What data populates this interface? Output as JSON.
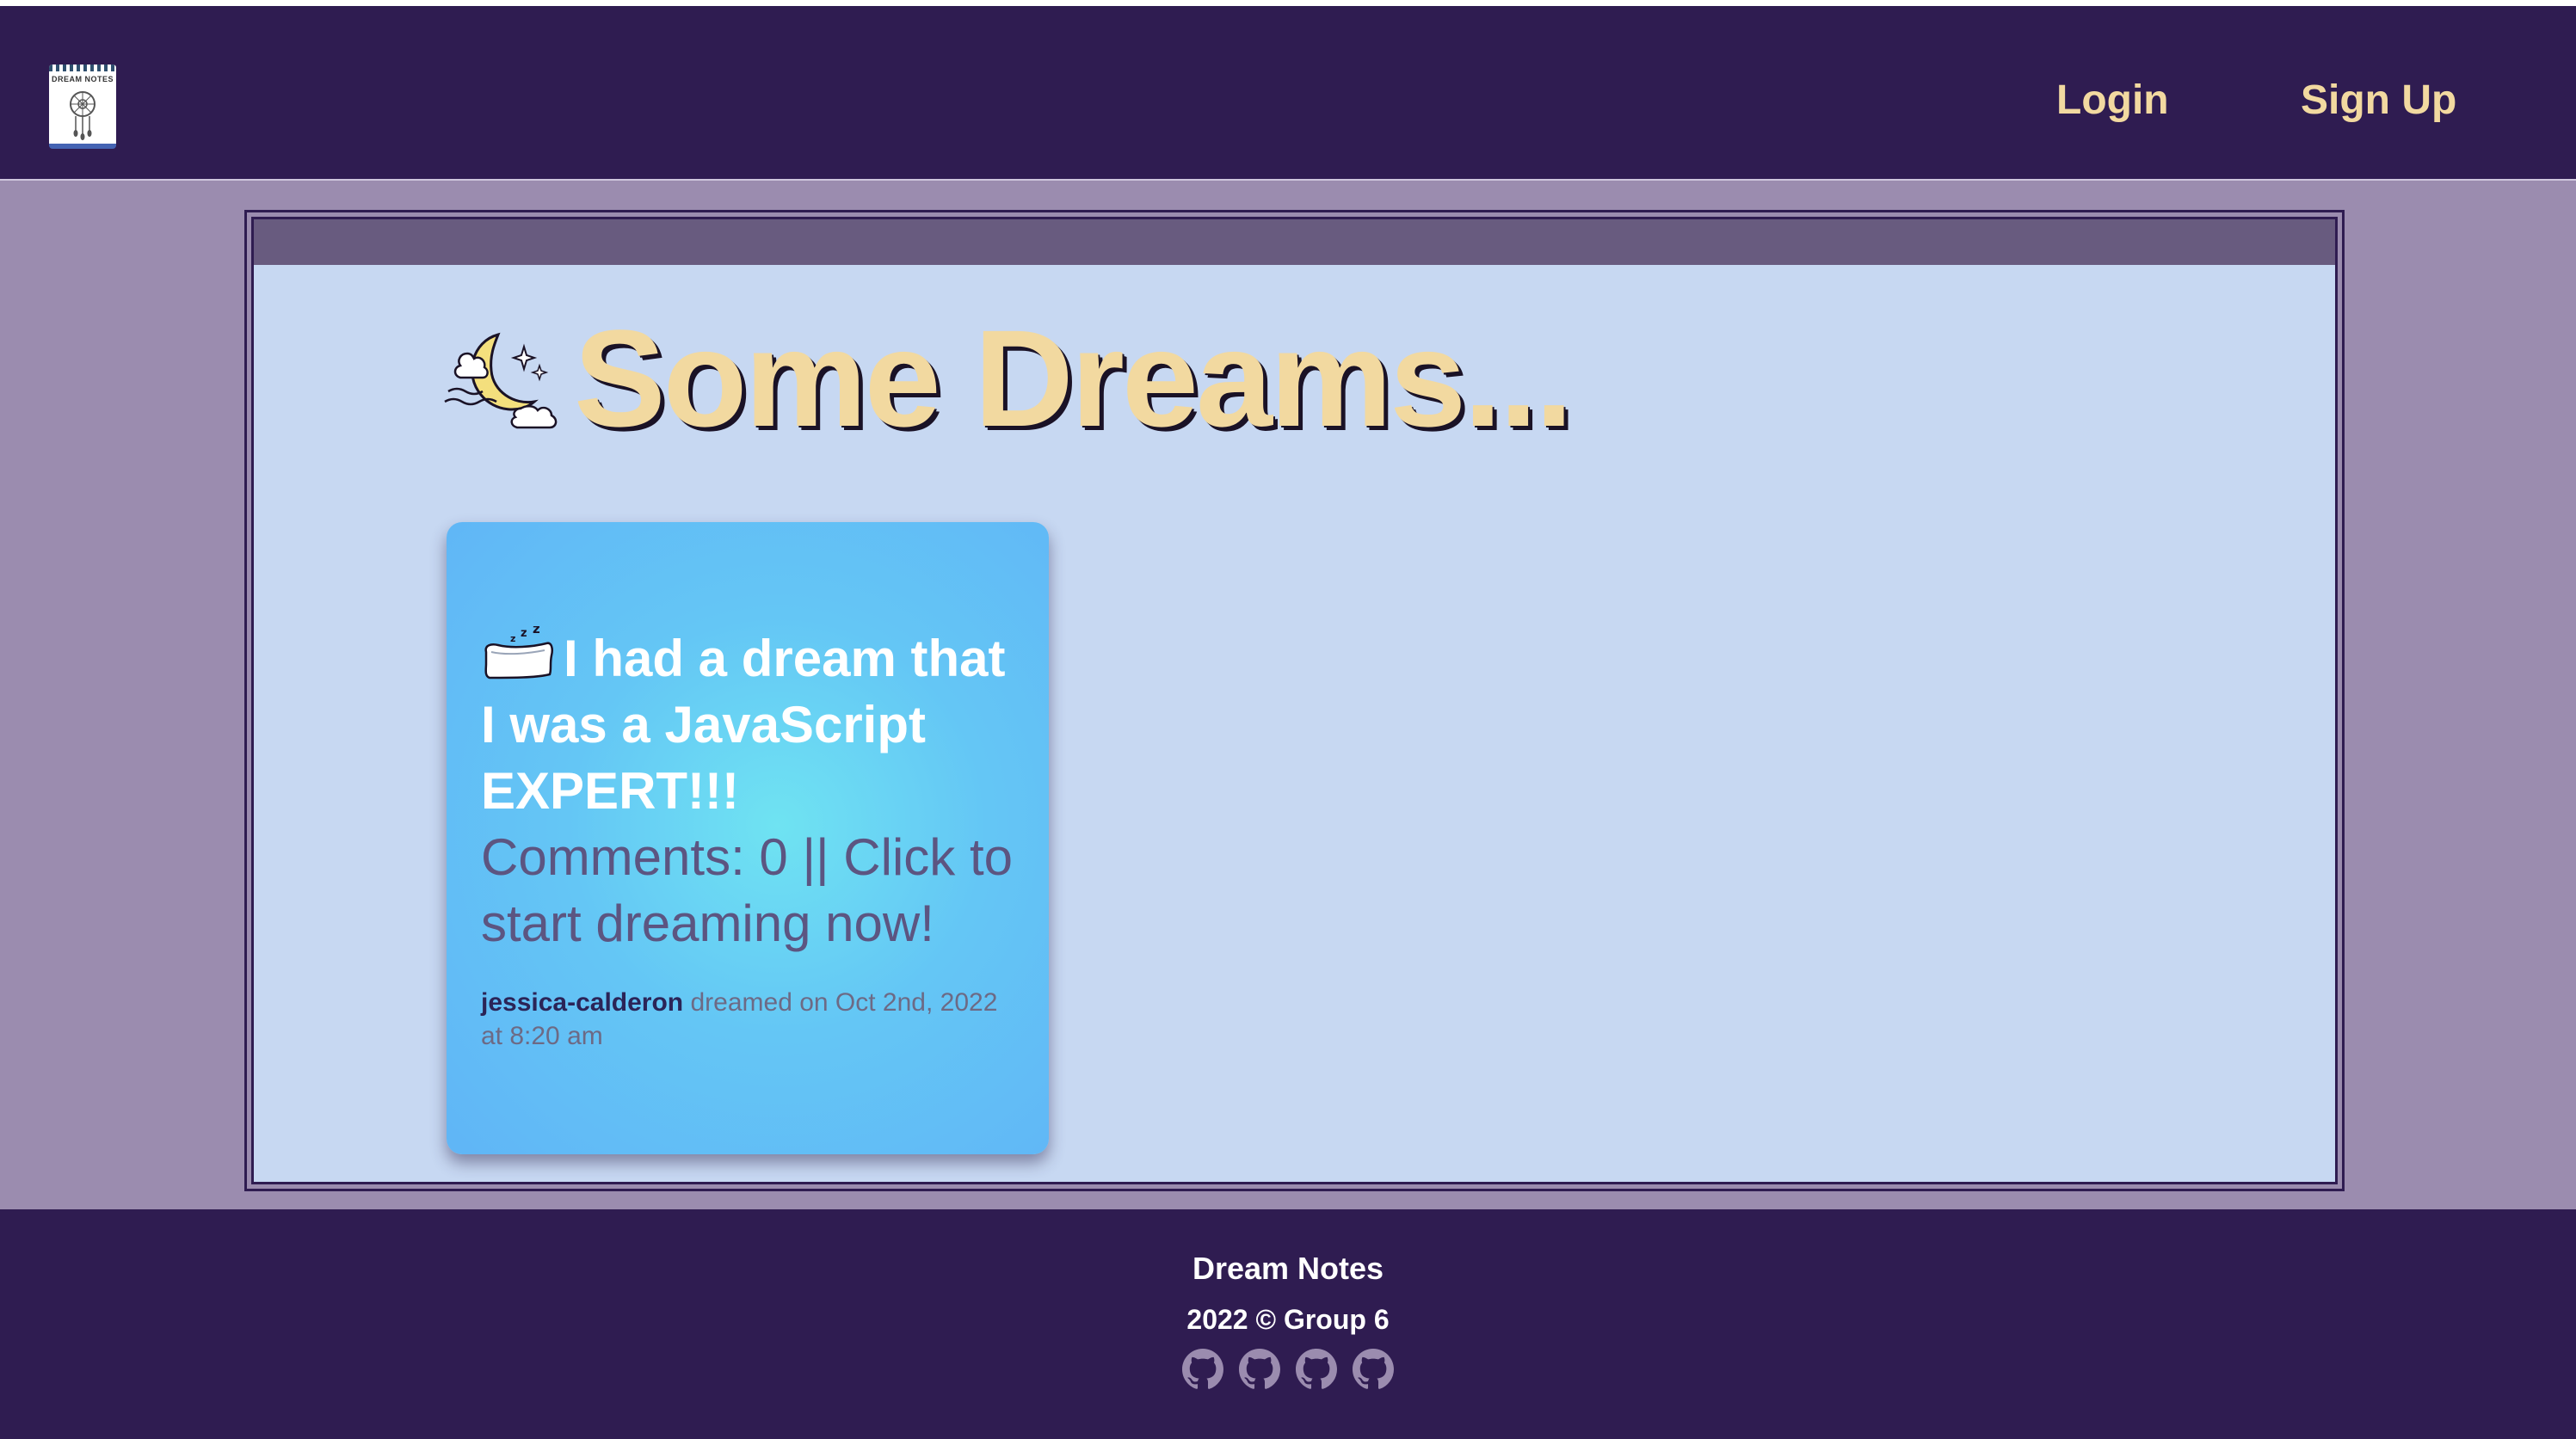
{
  "header": {
    "logo_icon": "dream-notes-notebook-icon",
    "logo_text": "DREAM NOTES",
    "nav": {
      "login_label": "Login",
      "signup_label": "Sign Up"
    }
  },
  "main": {
    "heading": {
      "icon": "moon-clouds-icon",
      "title": "Some Dreams..."
    },
    "cards": [
      {
        "icon": "pillow-zzz-icon",
        "title": "I had a dream that I was a JavaScript EXPERT!!!",
        "comments_text": "Comments: 0 || Click to start dreaming now!",
        "author": "jessica-calderon",
        "meta_text": "dreamed on Oct 2nd, 2022 at 8:20 am"
      }
    ]
  },
  "footer": {
    "title": "Dream Notes",
    "copyright": "2022 © Group 6",
    "icons": [
      "github-icon",
      "github-icon",
      "github-icon",
      "github-icon"
    ]
  },
  "colors": {
    "navy": "#2f1c51",
    "page_bg": "#9b8caf",
    "panel_bg": "#c7d8f2",
    "accent_gold": "#f2d9a0",
    "card_blue": "#60b5f6",
    "card_cyan": "#6fe3f2"
  }
}
